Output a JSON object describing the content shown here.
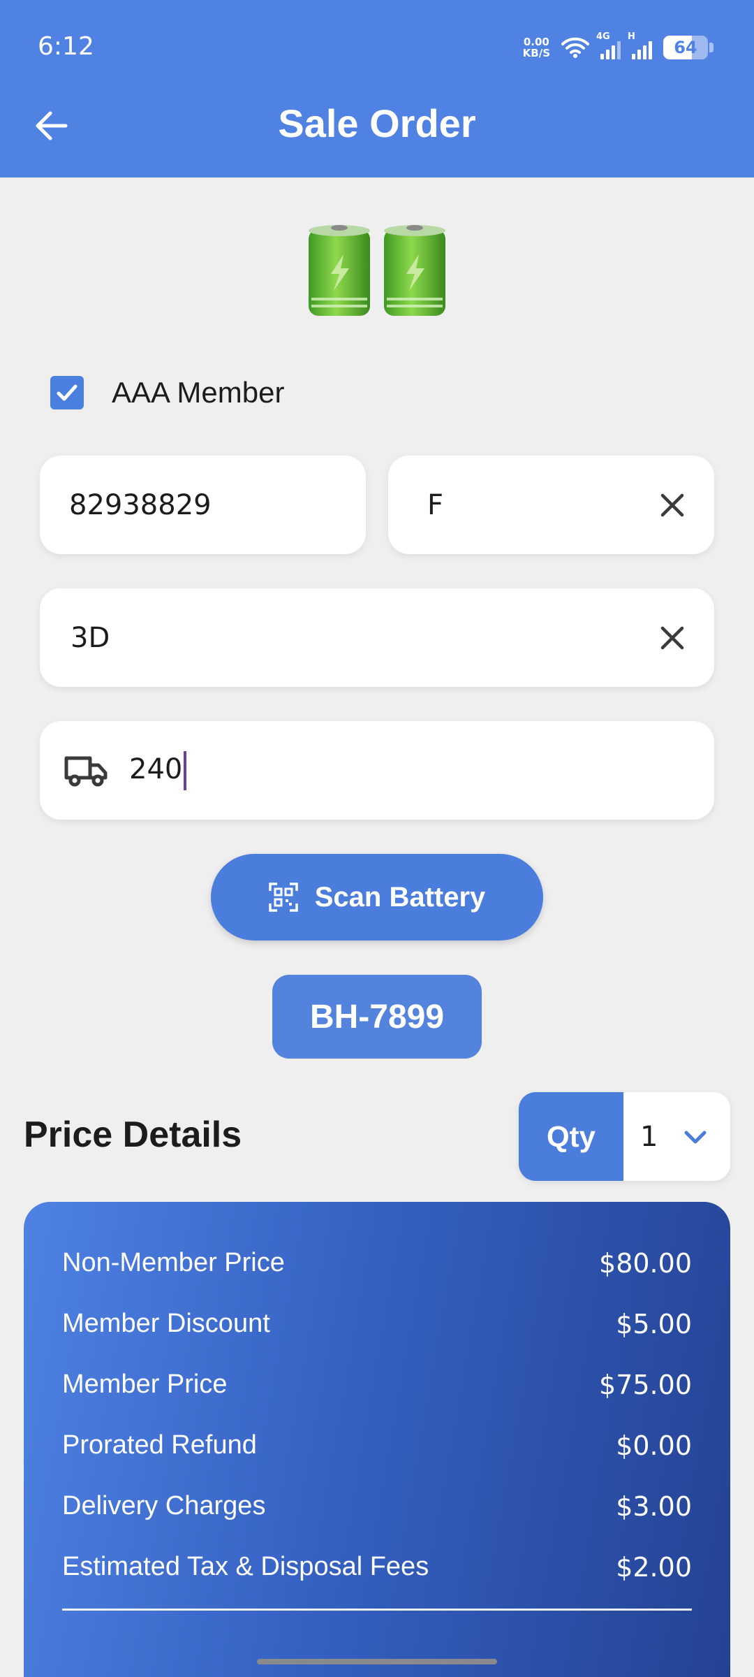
{
  "status_bar": {
    "time": "6:12",
    "net_speed_value": "0.00",
    "net_speed_unit": "KB/S",
    "signal1_tag": "4G",
    "signal2_tag": "H",
    "battery_level": "64",
    "battery_fraction": 0.64
  },
  "header": {
    "title": "Sale Order",
    "back_icon": "arrow-left-icon"
  },
  "product": {
    "image_icon": "battery-icon"
  },
  "member": {
    "checked": true,
    "label": "AAA Member"
  },
  "fields": {
    "member_number": "82938829",
    "first_field": "F",
    "group_field": "3D",
    "delivery_value": "240"
  },
  "actions": {
    "scan_label": "Scan Battery",
    "battery_code": "BH-7899"
  },
  "price_details": {
    "title": "Price Details",
    "qty_label": "Qty",
    "qty_value": "1",
    "rows": [
      {
        "label": "Non-Member Price",
        "amount": "$80.00"
      },
      {
        "label": "Member Discount",
        "amount": "$5.00"
      },
      {
        "label": "Member Price",
        "amount": "$75.00"
      },
      {
        "label": "Prorated Refund",
        "amount": "$0.00"
      },
      {
        "label": "Delivery Charges",
        "amount": "$3.00"
      },
      {
        "label": "Estimated Tax & Disposal Fees",
        "amount": "$2.00"
      }
    ]
  },
  "colors": {
    "primary": "#4f82e3",
    "button": "#4b7ddd",
    "card_gradient_end": "#244293",
    "background": "#efeff0"
  }
}
